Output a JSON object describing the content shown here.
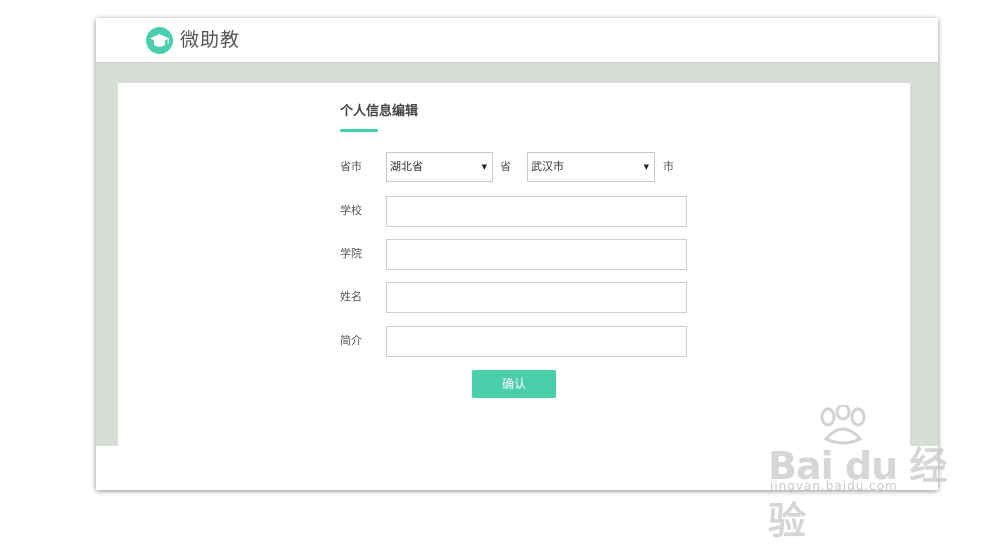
{
  "app": {
    "name": "微助教"
  },
  "colors": {
    "accent": "#4bcfab",
    "background_gray": "#d9ddd8"
  },
  "form": {
    "title": "个人信息编辑",
    "province_city_label": "省市",
    "province_value": "湖北省",
    "province_unit": "省",
    "city_value": "武汉市",
    "city_unit": "市",
    "school_label": "学校",
    "school_value": "",
    "college_label": "学院",
    "college_value": "",
    "name_label": "姓名",
    "name_value": "",
    "intro_label": "简介",
    "intro_value": "",
    "confirm_label": "确认"
  },
  "watermark": {
    "brand": "Bai du 经验",
    "site": "jingyan.baidu.com"
  }
}
